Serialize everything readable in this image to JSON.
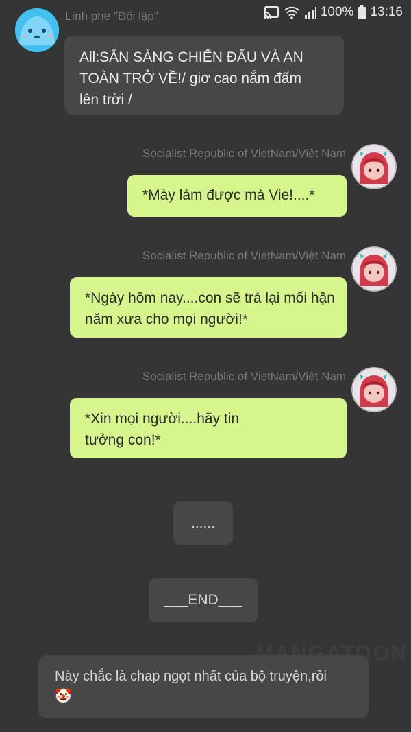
{
  "status_bar": {
    "battery": "100%",
    "time": "13:16",
    "icons": [
      "screen-cast-icon",
      "wifi-icon",
      "signal-icon",
      "battery-icon"
    ]
  },
  "messages": [
    {
      "sender": "Lính phe \"Đối lập\"",
      "side": "left",
      "text": "All:SẴN SÀNG CHIẾN ĐẤU VÀ AN TOÀN TRỞ VỀ!/ giơ cao nắm đấm lên trời /"
    },
    {
      "sender": "Socialist Republic of VietNam/Việt  Nam",
      "side": "right",
      "text": "*Mày làm được mà Vie!....*"
    },
    {
      "sender": "Socialist Republic of VietNam/Việt  Nam",
      "side": "right",
      "text": "*Ngày hôm nay....con sẽ trả lại mối hận năm xưa cho mọi người!*"
    },
    {
      "sender": "Socialist Republic of VietNam/Việt  Nam",
      "side": "right",
      "text": "*Xin mọi người....hãy tin tưởng con!*"
    }
  ],
  "ellipsis": "......",
  "end_marker": "___END___",
  "watermark": "MANGATOON",
  "footer_note": "Này chắc là chap ngọt nhất của bộ truyện,rồi🤡",
  "colors": {
    "background": "#353535",
    "bubble_gray": "#474747",
    "bubble_green": "#d6f58c",
    "sender_name": "#7b7b7b"
  }
}
